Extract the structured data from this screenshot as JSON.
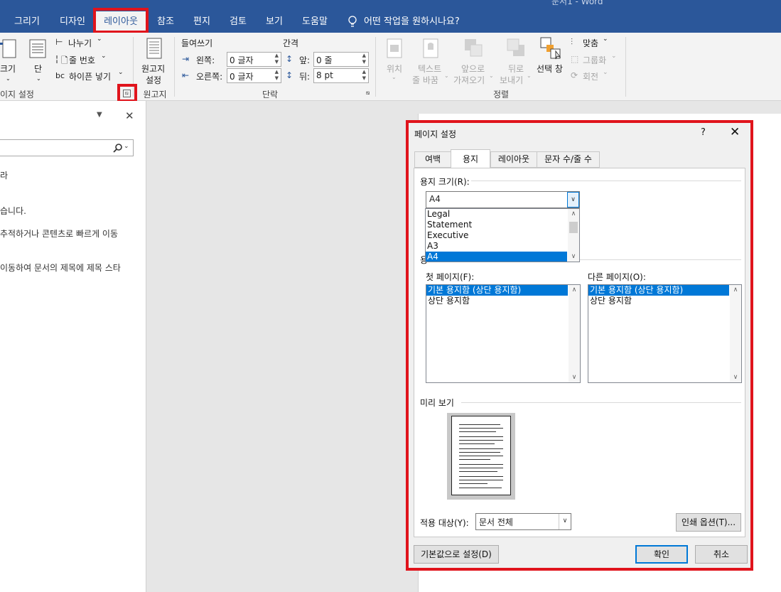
{
  "window": {
    "title_fragment": "문서1  -  Word"
  },
  "tabs": [
    {
      "label": "그리기"
    },
    {
      "label": "디자인"
    },
    {
      "label": "레이아웃"
    },
    {
      "label": "참조"
    },
    {
      "label": "편지"
    },
    {
      "label": "검토"
    },
    {
      "label": "보기"
    },
    {
      "label": "도움말"
    }
  ],
  "tell_me": "어떤 작업을 원하시나요?",
  "ribbon": {
    "page_setup": {
      "size_label": "크기",
      "columns_label": "단",
      "breaks_label": "나누기",
      "line_numbers_label": "줄 번호",
      "hyphenation_label": "하이픈 넣기",
      "group_label": "이지 설정"
    },
    "manuscript": {
      "button_line1": "원고지",
      "button_line2": "설정",
      "group_label": "원고지"
    },
    "paragraph": {
      "indent_header": "들여쓰기",
      "spacing_header": "간격",
      "left_label": "왼쪽:",
      "right_label": "오른쪽:",
      "left_value": "0 글자",
      "right_value": "0 글자",
      "before_label": "앞:",
      "after_label": "뒤:",
      "before_value": "0 줄",
      "after_value": "8 pt",
      "group_label": "단락"
    },
    "arrange": {
      "position_label": "위치",
      "wrap_line1": "텍스트",
      "wrap_line2": "줄 바꿈",
      "forward_line1": "앞으로",
      "forward_line2": "가져오기",
      "backward_line1": "뒤로",
      "backward_line2": "보내기",
      "selection_pane": "선택 창",
      "align_label": "맞춤",
      "group_label_btn": "그룹화",
      "rotate_label": "회전",
      "group_label": "정렬"
    }
  },
  "nav_pane": {
    "line1": "라",
    "line2": "습니다.",
    "line3": "추적하거나 콘텐츠로 빠르게 이동",
    "line4": "이동하여 문서의 제목에 제목 스타"
  },
  "dialog": {
    "title": "페이지 설정",
    "help": "?",
    "close": "✕",
    "tabs": [
      {
        "label": "여백"
      },
      {
        "label": "용지"
      },
      {
        "label": "레이아웃"
      },
      {
        "label": "문자 수/줄 수"
      }
    ],
    "paper_size_label": "용지 크기(R):",
    "paper_size_value": "A4",
    "paper_size_options": [
      "Legal",
      "Statement",
      "Executive",
      "A3",
      "A4"
    ],
    "paper_source_fragment": "용",
    "first_page_label": "첫 페이지(F):",
    "other_pages_label": "다른 페이지(O):",
    "first_page_items": [
      "기본 용지함 (상단 용지함)",
      "상단 용지함"
    ],
    "other_pages_items": [
      "기본 용지함 (상단 용지함)",
      "상단 용지함"
    ],
    "preview_label": "미리 보기",
    "apply_to_label": "적용 대상(Y):",
    "apply_to_value": "문서 전체",
    "print_options_button": "인쇄 옵션(T)...",
    "set_default_button": "기본값으로 설정(D)",
    "ok_button": "확인",
    "cancel_button": "취소"
  },
  "colors": {
    "accent": "#2b579a",
    "highlight": "#e0141c",
    "selection": "#0078d7"
  }
}
